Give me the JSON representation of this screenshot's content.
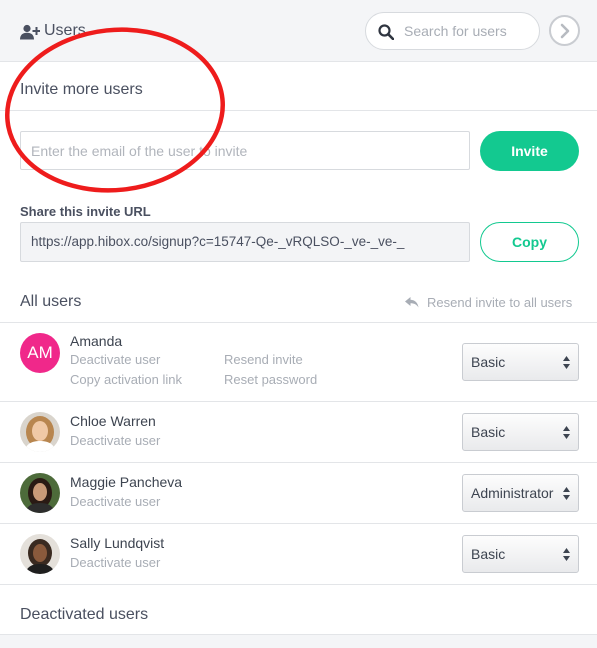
{
  "header": {
    "title": "Users",
    "search_placeholder": "Search for users"
  },
  "invite": {
    "title": "Invite more users",
    "email_placeholder": "Enter the email of the user to invite",
    "invite_button": "Invite",
    "share_label": "Share this invite URL",
    "share_url": "https://app.hibox.co/signup?c=15747-Qe-_vRQLSO-_ve-_ve-_",
    "copy_button": "Copy"
  },
  "all_users": {
    "title": "All users",
    "resend_all": "Resend invite to all users",
    "users": [
      {
        "name": "Amanda",
        "avatar_initials": "AM",
        "avatar_color": "#f0288a",
        "deactivate": "Deactivate user",
        "copy_activation": "Copy activation link",
        "resend_invite": "Resend invite",
        "reset_password": "Reset password",
        "role": "Basic"
      },
      {
        "name": "Chloe Warren",
        "deactivate": "Deactivate user",
        "role": "Basic"
      },
      {
        "name": "Maggie Pancheva",
        "deactivate": "Deactivate user",
        "role": "Administrator"
      },
      {
        "name": "Sally Lundqvist",
        "deactivate": "Deactivate user",
        "role": "Basic"
      }
    ]
  },
  "deactivated": {
    "title": "Deactivated users"
  },
  "colors": {
    "accent": "#13c990",
    "annotation": "#ee1c1c",
    "muted_text": "#a8adb5"
  }
}
